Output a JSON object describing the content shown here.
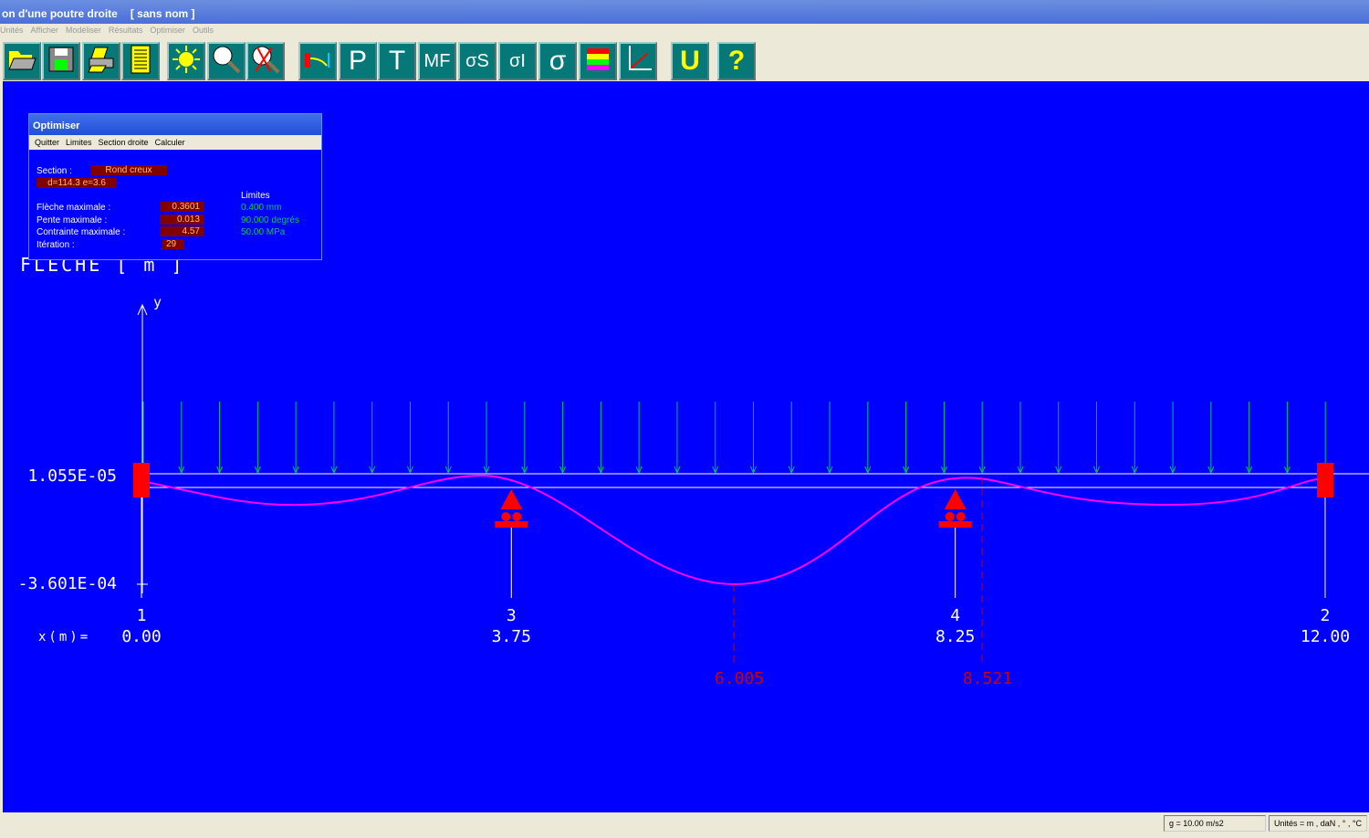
{
  "window": {
    "title": "on d'une poutre droite",
    "doc": "[ sans nom ]"
  },
  "menu": [
    "Unités",
    "Afficher",
    "Modéliser",
    "Résultats",
    "Optimiser",
    "Outils"
  ],
  "toolbar": [
    {
      "icon": "open-folder-icon",
      "label": ""
    },
    {
      "icon": "save-icon",
      "label": ""
    },
    {
      "icon": "print-icon",
      "label": ""
    },
    {
      "icon": "document-icon",
      "label": ""
    },
    {
      "icon": "sun-icon",
      "label": ""
    },
    {
      "icon": "zoom-icon",
      "label": ""
    },
    {
      "icon": "zoom-cancel-icon",
      "label": ""
    },
    {
      "icon": "deflection-icon",
      "label": ""
    },
    {
      "icon": "p-icon",
      "label": "P"
    },
    {
      "icon": "t-icon",
      "label": "T"
    },
    {
      "icon": "mf-icon",
      "label": "MF"
    },
    {
      "icon": "sigma-s-icon",
      "label": "σS"
    },
    {
      "icon": "sigma-i-icon",
      "label": "σI"
    },
    {
      "icon": "sigma-icon",
      "label": "σ"
    },
    {
      "icon": "color-scale-icon",
      "label": ""
    },
    {
      "icon": "graph-icon",
      "label": ""
    },
    {
      "icon": "u-icon",
      "label": "U"
    },
    {
      "icon": "help-icon",
      "label": "?"
    }
  ],
  "optimiser": {
    "title": "Optimiser",
    "menu": [
      "Quitter",
      "Limites",
      "Section droite",
      "Calculer"
    ],
    "section_label": "Section :",
    "section_value": "Rond creux",
    "section_dims": "d=114.3 e=3.6",
    "limites_label": "Limites",
    "rows": [
      {
        "label": "Flèche maximale :",
        "value": "0.3601",
        "limit": "0.400 mm"
      },
      {
        "label": "Pente maximale :",
        "value": "0.013",
        "limit": "90.000 degrés"
      },
      {
        "label": "Contrainte maximale :",
        "value": "4.57",
        "limit": "50.00 MPa"
      },
      {
        "label": "Itération :",
        "value": "29",
        "limit": ""
      }
    ]
  },
  "plot": {
    "title": "FLECHE [ m ]",
    "y_axis": "y",
    "ymax_label": "1.055E-05",
    "ymin_label": "-3.601E-04",
    "x_prefix": "x(m)=",
    "nodes": [
      {
        "id": "1",
        "x": "0.00",
        "xv": 0
      },
      {
        "id": "3",
        "x": "3.75",
        "xv": 3.75
      },
      {
        "id": "4",
        "x": "8.25",
        "xv": 8.25
      },
      {
        "id": "2",
        "x": "12.00",
        "xv": 12
      }
    ],
    "extrema": [
      {
        "x": "6.005",
        "xv": 6.005
      },
      {
        "x": "8.521",
        "xv": 8.521
      }
    ],
    "colors": {
      "bg": "#0000ff",
      "curve": "#ff00ff",
      "load": "#00c060",
      "support": "#ff0000",
      "extrema": "#cc0000"
    }
  },
  "status": {
    "gravity": "g = 10.00 m/s2",
    "units": "Unités = m , daN , ° , °C"
  }
}
